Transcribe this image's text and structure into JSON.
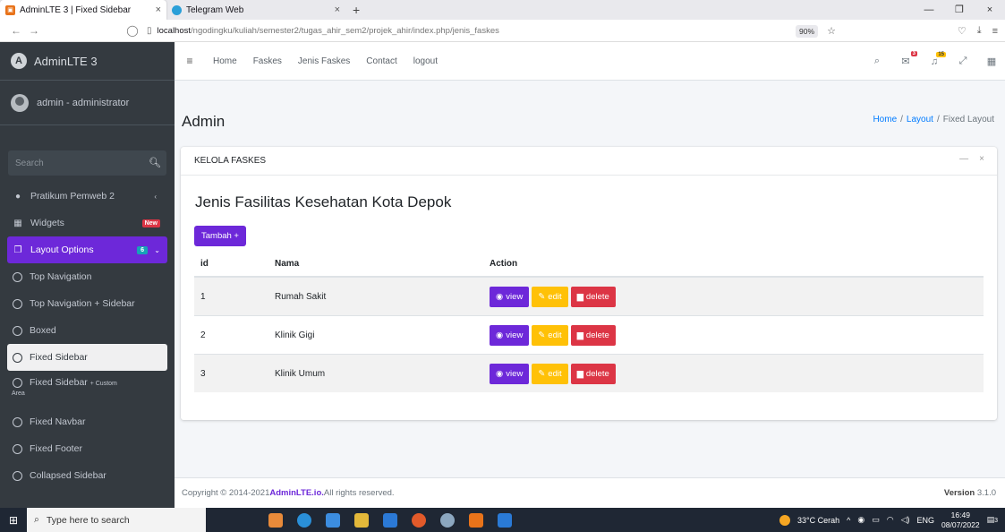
{
  "browser": {
    "tabs": [
      {
        "title": "AdminLTE 3 | Fixed Sidebar",
        "close": "×"
      },
      {
        "title": "Telegram Web",
        "close": "×"
      }
    ],
    "new_tab": "+",
    "window_controls": [
      "—",
      "❐",
      "×"
    ],
    "url_host": "localhost",
    "url_path": "/ngodingku/kuliah/semester2/tugas_ahir_sem2/projek_ahir/index.php/jenis_faskes",
    "zoom": "90%"
  },
  "sidebar": {
    "brand": "AdminLTE 3",
    "user": "admin - administrator",
    "search_placeholder": "Search",
    "items": [
      {
        "label": "Pratikum Pemweb 2"
      },
      {
        "label": "Widgets",
        "badge": "New"
      },
      {
        "label": "Layout Options",
        "badge": "6"
      },
      {
        "label": "Top Navigation"
      },
      {
        "label": "Top Navigation + Sidebar"
      },
      {
        "label": "Boxed"
      },
      {
        "label": "Fixed Sidebar"
      },
      {
        "label": "Fixed Sidebar",
        "suffix": "+ Custom",
        "second_line": "Area"
      },
      {
        "label": "Fixed Navbar"
      },
      {
        "label": "Fixed Footer"
      },
      {
        "label": "Collapsed Sidebar"
      }
    ]
  },
  "topnav": {
    "links": [
      "Home",
      "Faskes",
      "Jenis Faskes",
      "Contact",
      "logout"
    ],
    "badges": {
      "messages": "3",
      "notifications": "15"
    }
  },
  "content": {
    "title": "Admin",
    "breadcrumb": [
      "Home",
      "Layout",
      "Fixed Layout"
    ],
    "breadcrumb_sep": "/",
    "card_title": "KELOLA FASKES",
    "card_tools": [
      "—",
      "×"
    ],
    "heading": "Jenis Fasilitas Kesehatan Kota Depok",
    "add_button": "Tambah +",
    "table": {
      "columns": [
        "id",
        "Nama",
        "Action"
      ],
      "rows": [
        {
          "id": "1",
          "nama": "Rumah Sakit"
        },
        {
          "id": "2",
          "nama": "Klinik Gigi"
        },
        {
          "id": "3",
          "nama": "Klinik Umum"
        }
      ],
      "actions": {
        "view": "view",
        "edit": "edit",
        "delete": "delete"
      }
    }
  },
  "footer": {
    "copyright_prefix": "Copyright © 2014-2021 ",
    "copyright_link": "AdminLTE.io.",
    "copyright_suffix": " All rights reserved.",
    "version_label": "Version",
    "version": "3.1.0"
  },
  "taskbar": {
    "search_placeholder": "Type here to search",
    "weather": "33°C  Cerah",
    "lang": "ENG",
    "time": "16:49",
    "date": "08/07/2022",
    "notif_count": "3"
  },
  "colors": {
    "accent": "#6d28d9",
    "sidebar": "#343a40",
    "warning": "#ffc107",
    "danger": "#dc3545"
  }
}
